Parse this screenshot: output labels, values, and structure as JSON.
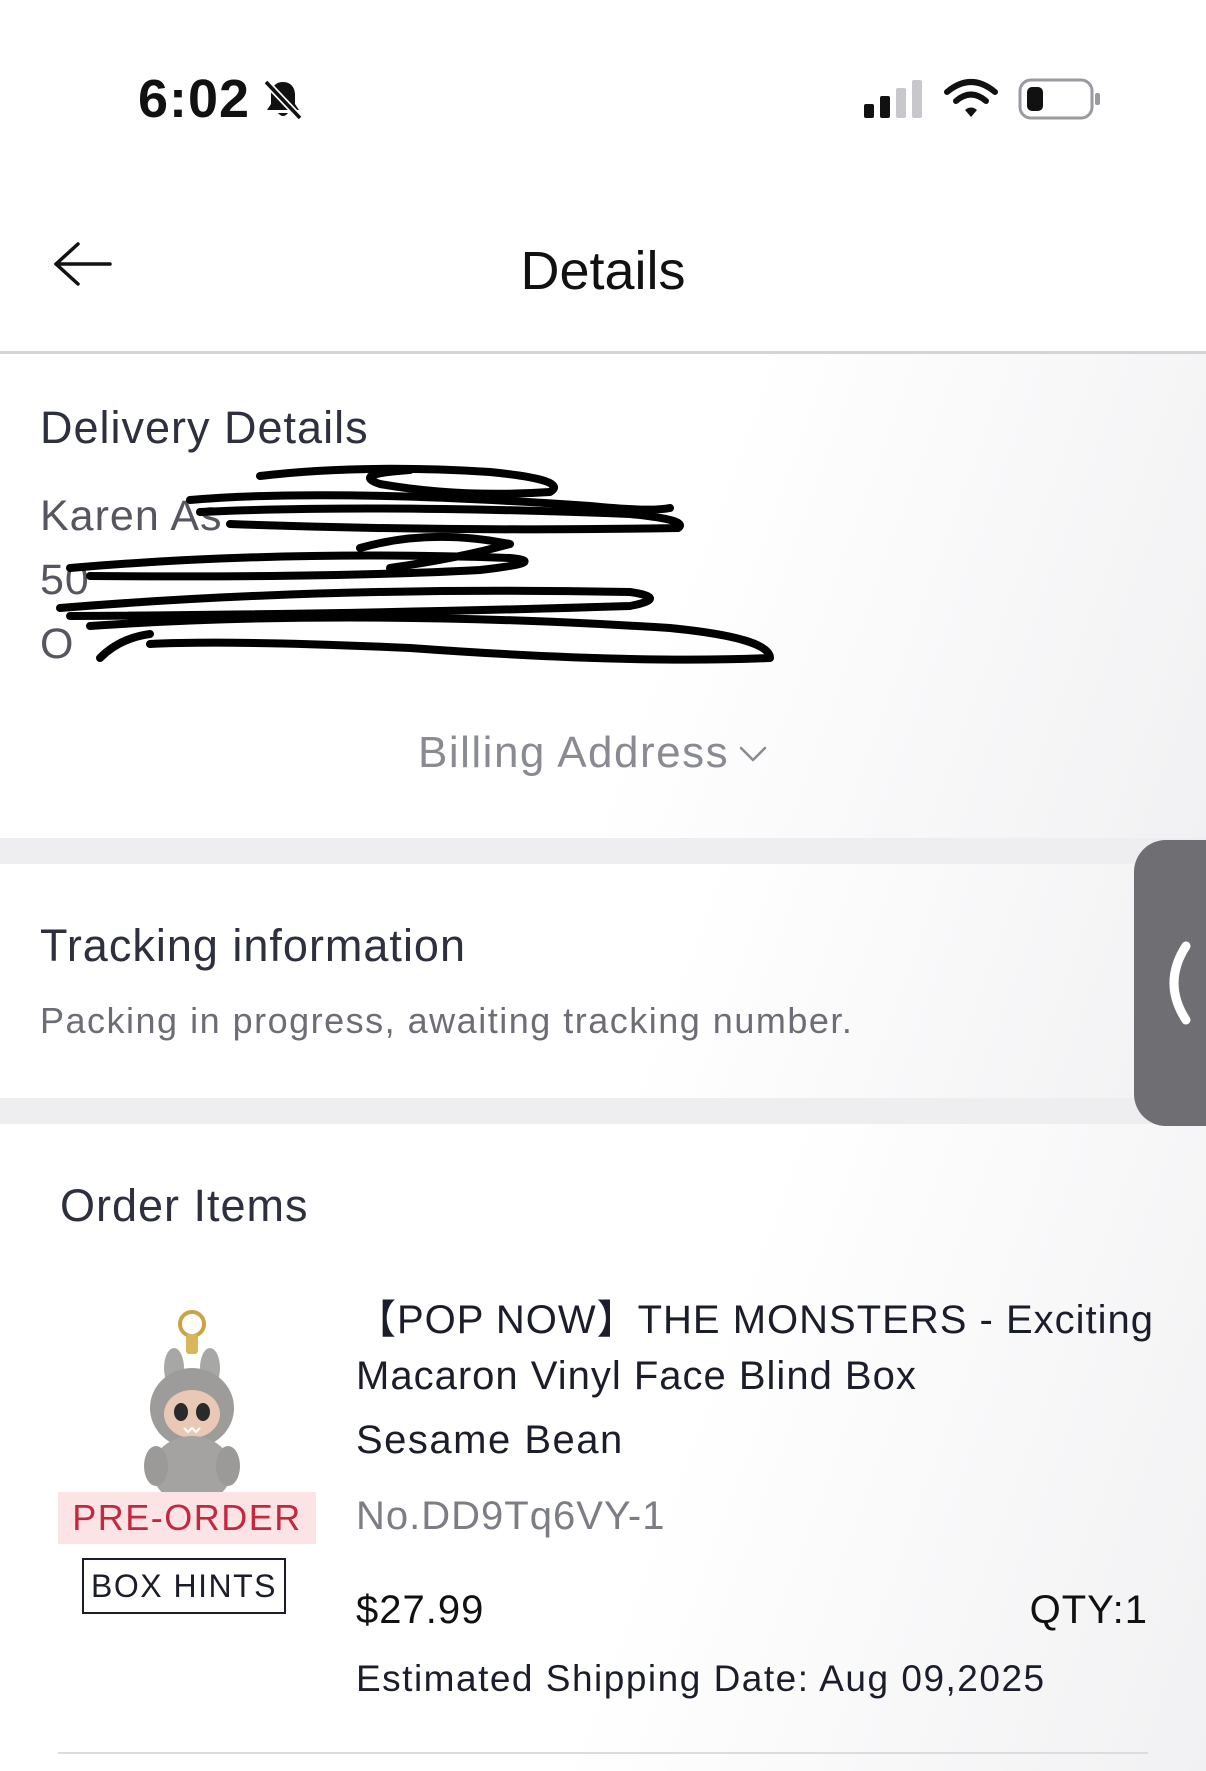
{
  "status_bar": {
    "time": "6:02"
  },
  "header": {
    "title": "Details"
  },
  "delivery": {
    "title": "Delivery Details",
    "lines": [
      "Karen As",
      "50",
      "O"
    ],
    "billing_label": "Billing Address"
  },
  "tracking": {
    "title": "Tracking information",
    "status": "Packing in progress, awaiting tracking number."
  },
  "order": {
    "title": "Order Items",
    "item": {
      "name_line1": "【POP NOW】THE MONSTERS - Exciting",
      "name_line2": "Macaron Vinyl Face Blind Box",
      "variant": "Sesame Bean",
      "sku": "No.DD9Tq6VY-1",
      "price": "$27.99",
      "qty": "QTY:1",
      "shipping": "Estimated Shipping Date: Aug 09,2025",
      "badge": "PRE-ORDER",
      "hints_button": "BOX HINTS"
    }
  },
  "colors": {
    "preorder_text": "#c4283c",
    "preorder_bg": "#fbe3e6",
    "side_tab": "#6f6f73"
  },
  "icons": [
    "bell-slash-icon",
    "cellular-signal-icon",
    "wifi-icon",
    "battery-icon",
    "back-arrow-icon",
    "chevron-down-icon",
    "chevron-left-icon"
  ]
}
